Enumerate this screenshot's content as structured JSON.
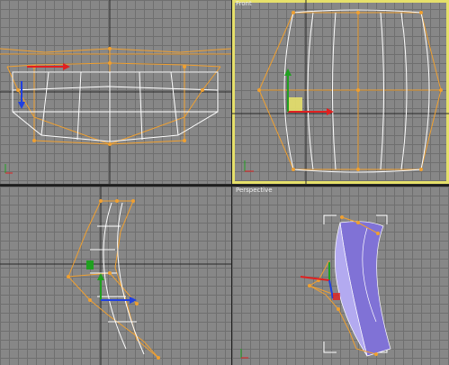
{
  "viewports": {
    "top": {
      "label": ""
    },
    "front": {
      "label": "Front",
      "active": true
    },
    "left": {
      "label": ""
    },
    "perspective": {
      "label": "Perspective"
    }
  },
  "colors": {
    "grid_bg": "#878787",
    "grid_line": "#6f6f6f",
    "axis_line": "#2a2a2a",
    "active_border": "#e6e06a",
    "cage": "#f0a030",
    "wire": "#ffffff",
    "gizmo_x": "#e02020",
    "gizmo_y": "#20a020",
    "gizmo_z": "#2040e0",
    "mesh_fill": "#9b8fe6"
  },
  "icons": [
    "axis-tripod-icon",
    "move-gizmo-icon"
  ]
}
